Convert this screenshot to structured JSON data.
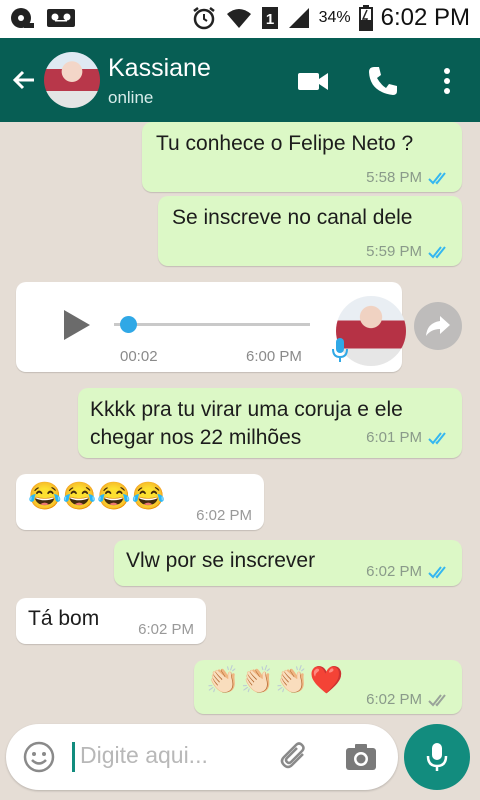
{
  "status_bar": {
    "battery_percent": "34%",
    "time": "6:02 PM",
    "icons": [
      "voicemail-icon",
      "tape-icon",
      "alarm-icon",
      "wifi-icon",
      "sim-1-icon",
      "signal-icon",
      "battery-icon"
    ]
  },
  "header": {
    "contact_name": "Kassiane",
    "status": "online",
    "icons": [
      "back-arrow-icon",
      "video-call-icon",
      "phone-icon",
      "more-options-icon"
    ]
  },
  "messages": [
    {
      "direction": "out",
      "text": "Tu conhece o Felipe Neto ?",
      "time": "5:58 PM",
      "read": true
    },
    {
      "direction": "out",
      "text": "Se inscreve no canal dele",
      "time": "5:59 PM",
      "read": true
    },
    {
      "direction": "in",
      "type": "voice",
      "duration": "00:02",
      "time": "6:00 PM",
      "progress": 0
    },
    {
      "direction": "out",
      "text": "Kkkk pra tu virar uma coruja e ele chegar nos 22 milhões",
      "time": "6:01 PM",
      "read": true
    },
    {
      "direction": "in",
      "text": "😂😂😂😂",
      "time": "6:02 PM"
    },
    {
      "direction": "out",
      "text": "Vlw por se inscrever",
      "time": "6:02 PM",
      "read": true
    },
    {
      "direction": "in",
      "text": "Tá bom",
      "time": "6:02 PM"
    },
    {
      "direction": "out",
      "text": "👏🏻👏🏻👏🏻❤️",
      "time": "6:02 PM",
      "read": false
    }
  ],
  "input": {
    "placeholder": "Digite aqui..."
  },
  "colors": {
    "header": "#075e54",
    "outgoing_bubble": "#dcf8c6",
    "incoming_bubble": "#ffffff",
    "read_ticks": "#34b7f1",
    "accent": "#128c7e",
    "chat_background": "#e5ddd5"
  }
}
